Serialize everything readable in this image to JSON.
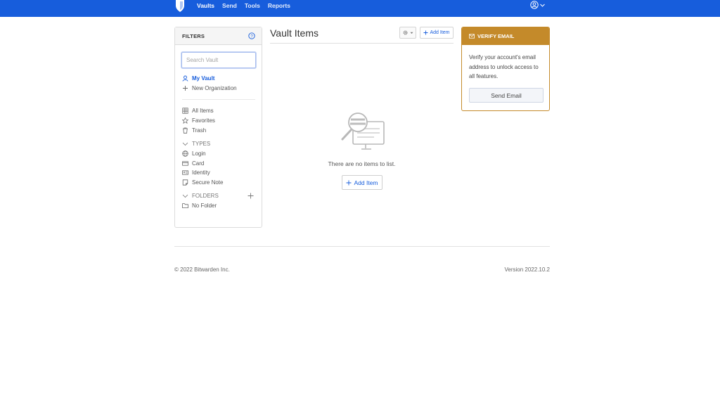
{
  "nav": {
    "items": [
      {
        "label": "Vaults",
        "active": true
      },
      {
        "label": "Send",
        "active": false
      },
      {
        "label": "Tools",
        "active": false
      },
      {
        "label": "Reports",
        "active": false
      }
    ]
  },
  "filters": {
    "title": "FILTERS",
    "search_placeholder": "Search Vault",
    "my_vault": "My Vault",
    "new_org": "New Organization",
    "all_items": "All Items",
    "favorites": "Favorites",
    "trash": "Trash",
    "types_label": "TYPES",
    "types": [
      "Login",
      "Card",
      "Identity",
      "Secure Note"
    ],
    "folders_label": "FOLDERS",
    "no_folder": "No Folder"
  },
  "main": {
    "title": "Vault Items",
    "add_item": "Add Item",
    "empty_text": "There are no items to list.",
    "empty_add_item": "Add Item"
  },
  "verify": {
    "title": "VERIFY EMAIL",
    "body": "Verify your account's email address to unlock access to all features.",
    "button": "Send Email"
  },
  "footer": {
    "copyright": "© 2022 Bitwarden Inc.",
    "version": "Version 2022.10.2"
  },
  "colors": {
    "brand": "#175ddc",
    "warning": "#c48a2a"
  }
}
